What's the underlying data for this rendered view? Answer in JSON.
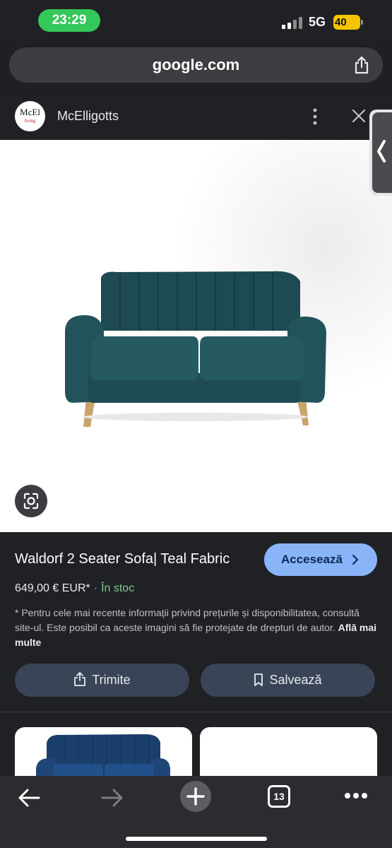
{
  "status_bar": {
    "time": "23:29",
    "network": "5G",
    "battery": "40"
  },
  "browser": {
    "url": "google.com"
  },
  "site": {
    "name": "McElligotts",
    "logo_text": "McEl",
    "logo_subtext": "living"
  },
  "product": {
    "title": "Waldorf 2 Seater Sofa| Teal Fabric",
    "visit_label": "Accesează",
    "price": "649,00 € EUR*",
    "separator": "·",
    "stock": "În stoc",
    "disclaimer": "* Pentru cele mai recente informații privind prețurile și disponibilitatea, consultă site-ul. Este posibil ca aceste imagini să fie protejate de drepturi de autor.",
    "learn_more": "Află mai multe"
  },
  "actions": {
    "send_label": "Trimite",
    "save_label": "Salvează"
  },
  "toolbar": {
    "tab_count": "13"
  },
  "colors": {
    "accent_blue": "#8ab4f8",
    "stock_green": "#81c995",
    "time_green": "#34c759",
    "battery_yellow": "#f4c400",
    "sofa_teal": "#1f4f57"
  }
}
